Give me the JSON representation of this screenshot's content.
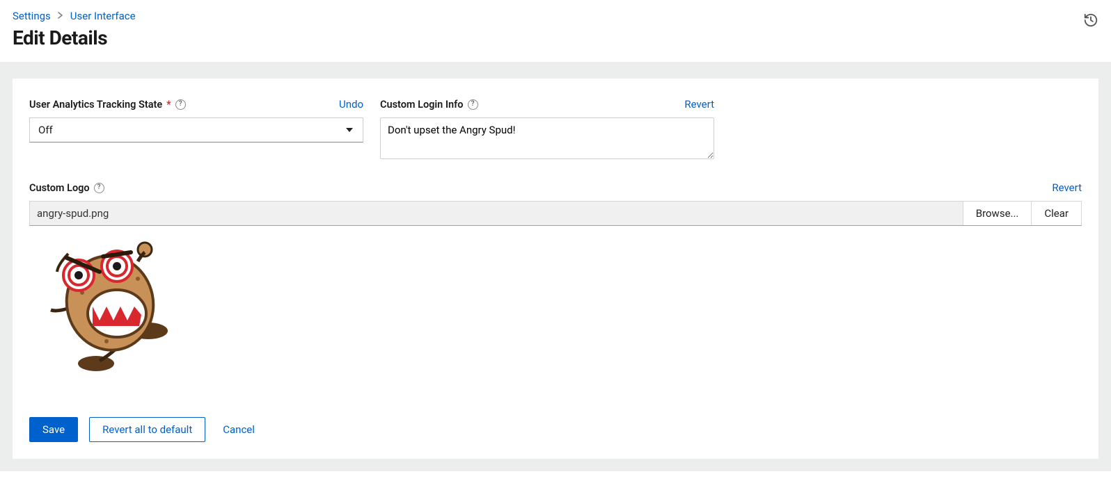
{
  "breadcrumb": {
    "settings": "Settings",
    "ui": "User Interface"
  },
  "page_title": "Edit Details",
  "fields": {
    "analytics": {
      "label": "User Analytics Tracking State",
      "action": "Undo",
      "value": "Off"
    },
    "login_info": {
      "label": "Custom Login Info",
      "action": "Revert",
      "value": "Don't upset the Angry Spud!"
    },
    "logo": {
      "label": "Custom Logo",
      "action": "Revert",
      "filename": "angry-spud.png",
      "browse": "Browse...",
      "clear": "Clear"
    }
  },
  "actions": {
    "save": "Save",
    "revert_all": "Revert all to default",
    "cancel": "Cancel"
  }
}
